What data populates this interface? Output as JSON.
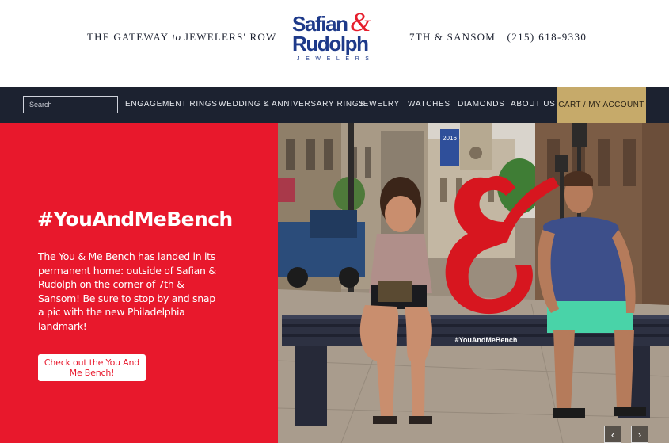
{
  "header": {
    "tagline_pre": "THE GATEWAY",
    "tagline_it": "to",
    "tagline_post": "JEWELERS' ROW",
    "address": "7TH & SANSOM",
    "phone": "(215) 618-9330",
    "logo": {
      "line1": "Safian",
      "amp": "&",
      "line2": "Rudolph",
      "sub": "JEWELERS"
    }
  },
  "nav": {
    "search_placeholder": "Search",
    "items": [
      "ENGAGEMENT RINGS",
      "WEDDING & ANNIVERSARY RINGS",
      "JEWELRY",
      "WATCHES",
      "DIAMONDS",
      "ABOUT US"
    ],
    "cart": "CART / MY ACCOUNT"
  },
  "hero": {
    "title": "#YouAndMeBench",
    "body": "The You & Me Bench has landed in its permanent home: outside of Safian & Rudolph on the corner of 7th & Sansom! Be sure to stop by and snap a pic with the new Philadelphia landmark!",
    "button": "Check out the You And Me Bench!",
    "bench_tag": "#YouAndMeBench",
    "banner_text": "2016",
    "prev": "‹",
    "next": "›"
  },
  "colors": {
    "navy": "#1c2230",
    "red": "#e8182c",
    "gold": "#c6aa6a",
    "logo_blue": "#1e3a8a"
  }
}
